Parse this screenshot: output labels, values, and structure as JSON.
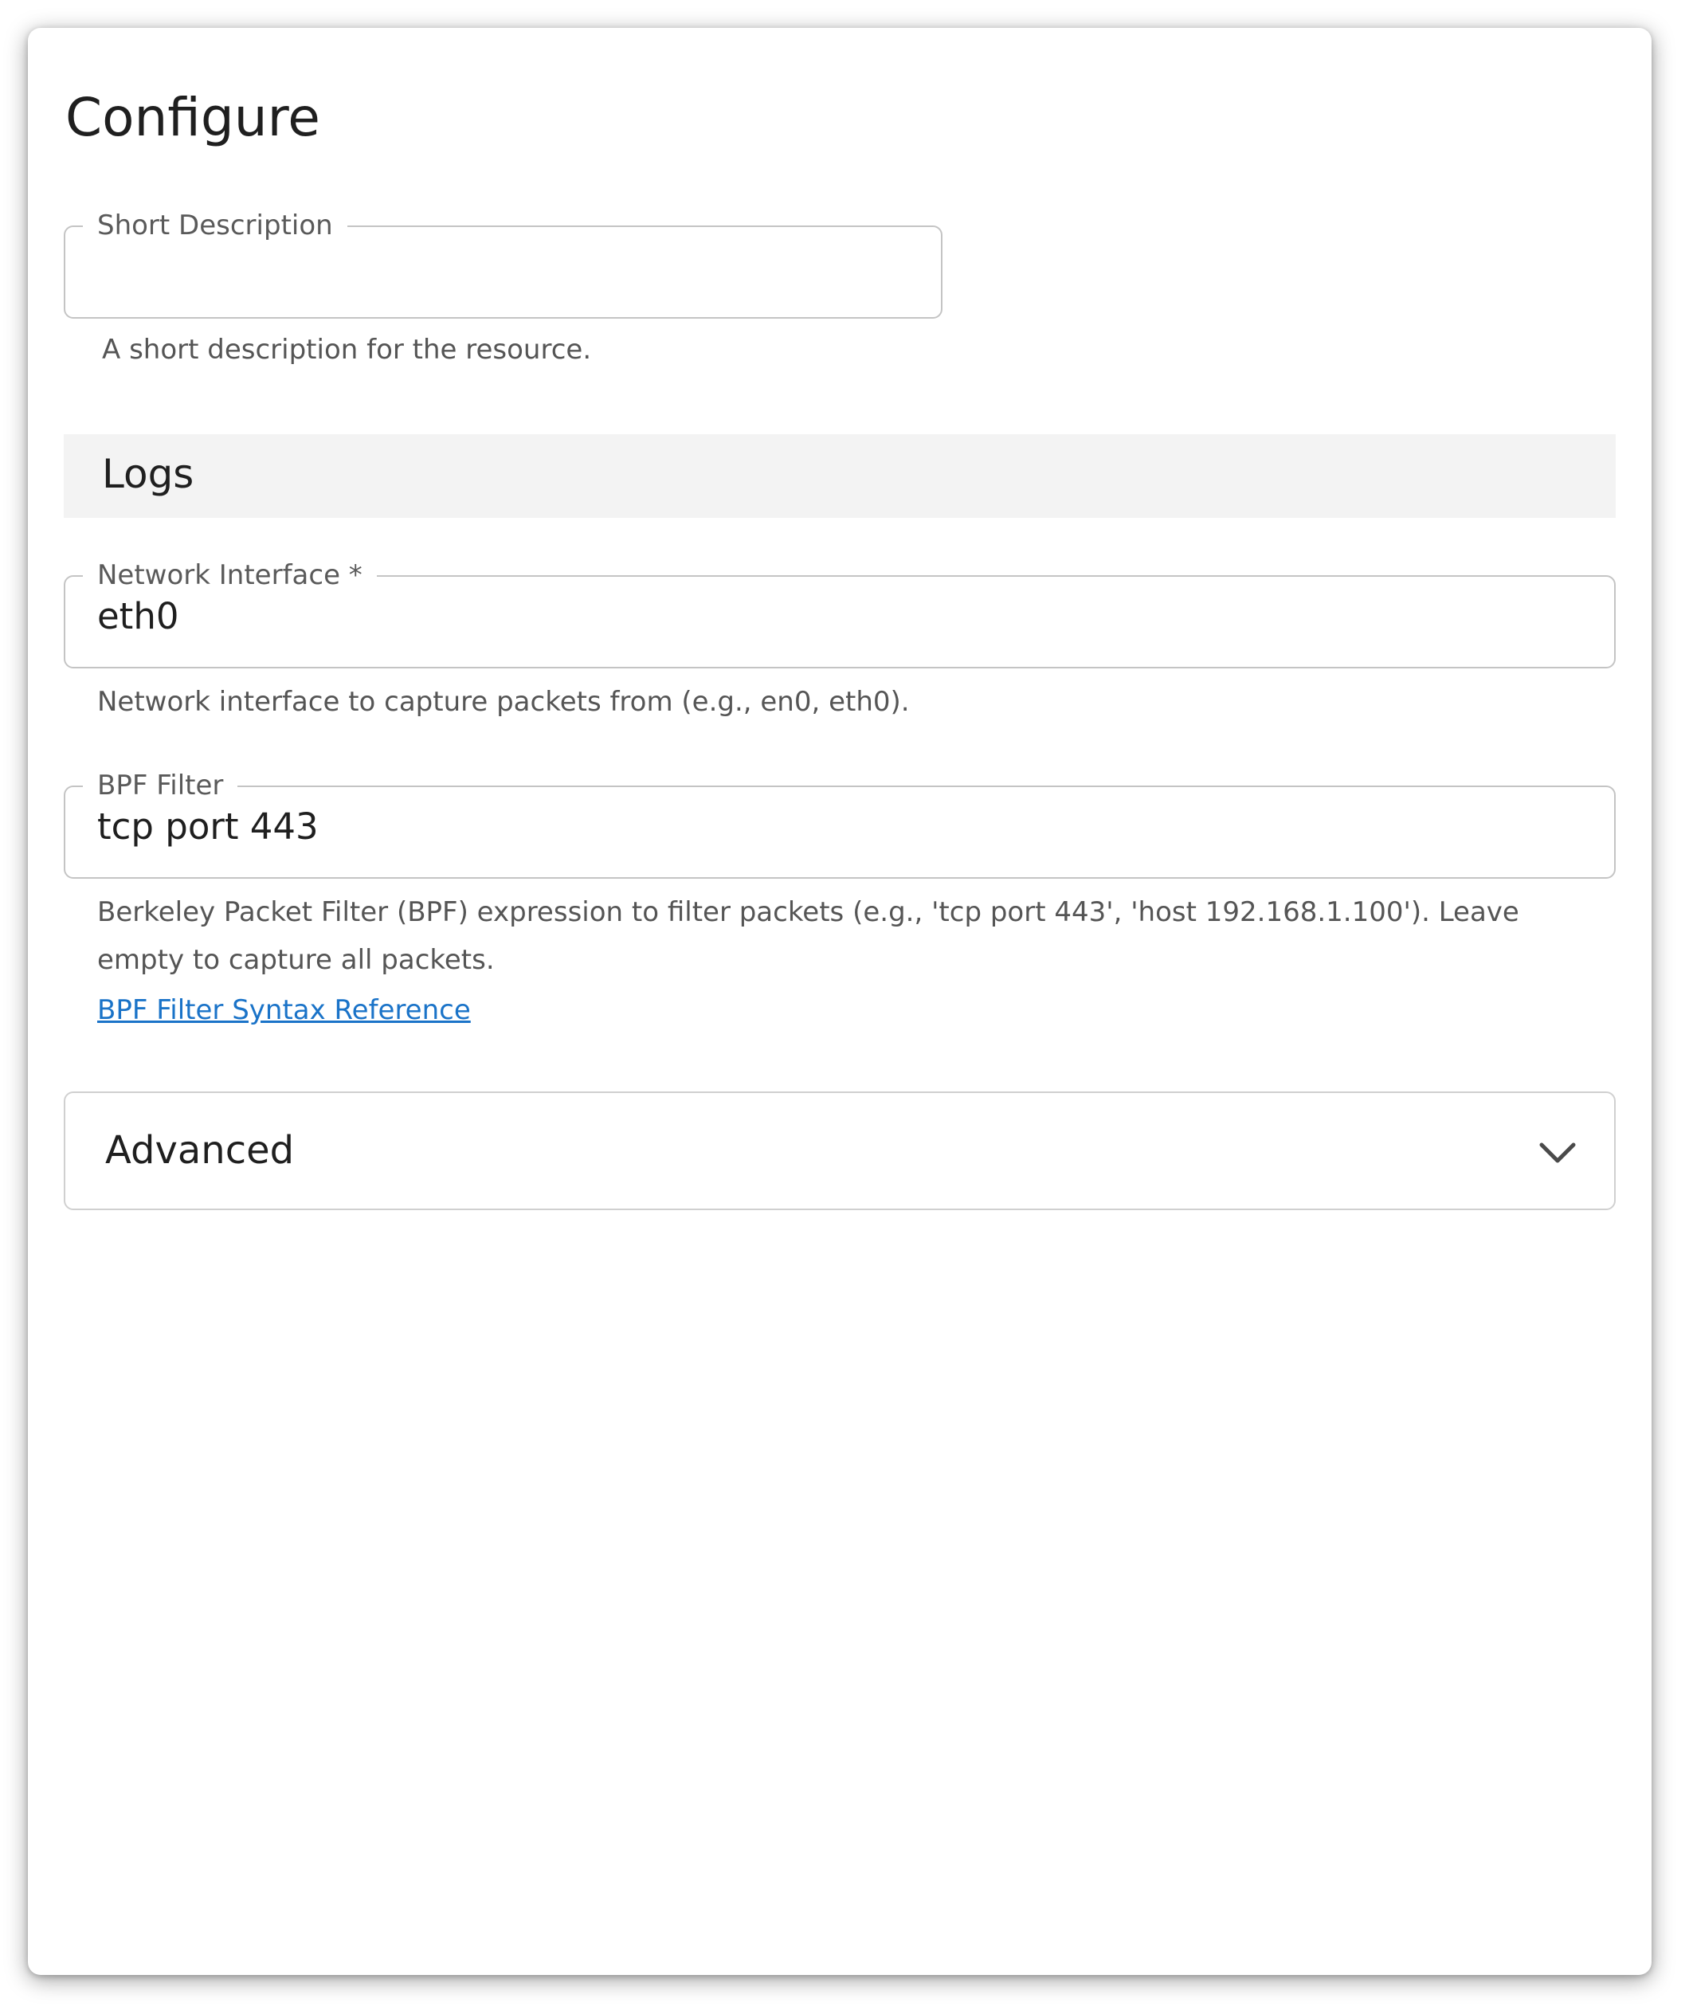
{
  "page": {
    "title": "Configure"
  },
  "short_description": {
    "label": "Short Description",
    "value": "",
    "helper": "A short description for the resource."
  },
  "logs_section": {
    "title": "Logs"
  },
  "network_interface": {
    "label": "Network Interface *",
    "value": "eth0",
    "helper": "Network interface to capture packets from (e.g., en0, eth0)."
  },
  "bpf_filter": {
    "label": "BPF Filter",
    "value": "tcp port 443",
    "helper": "Berkeley Packet Filter (BPF) expression to filter packets (e.g., 'tcp port 443', 'host 192.168.1.100'). Leave empty to capture all packets.",
    "link_text": "BPF Filter Syntax Reference"
  },
  "advanced": {
    "label": "Advanced",
    "icon": "chevron-down-icon",
    "expanded": false
  },
  "colors": {
    "link": "#1a73c8",
    "section_background": "#f3f3f3",
    "field_border": "#c4c4c4"
  }
}
